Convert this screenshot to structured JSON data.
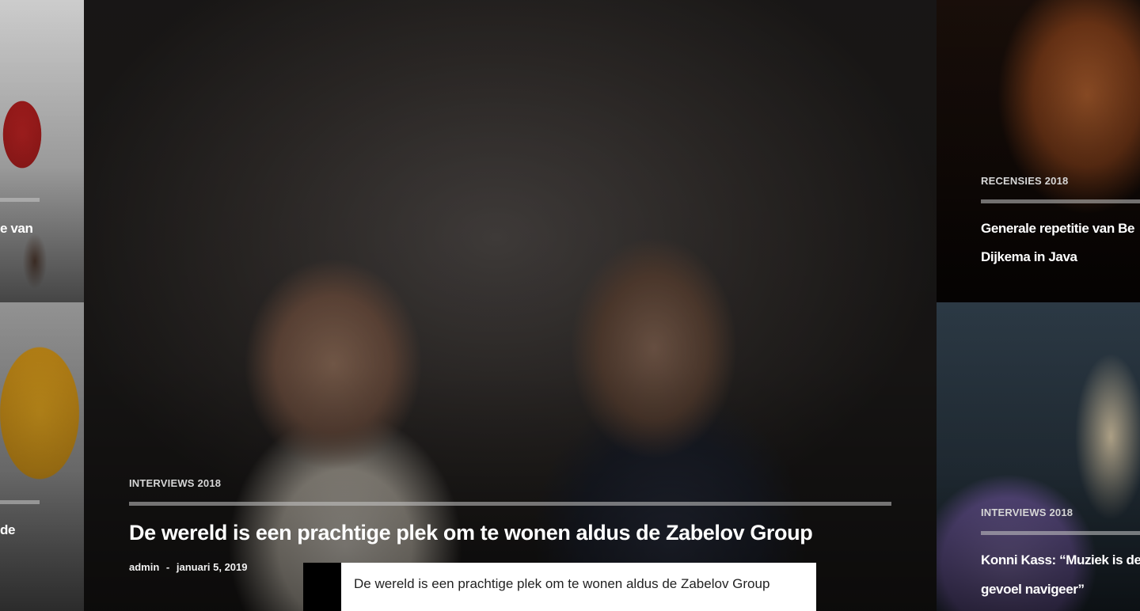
{
  "hero": {
    "category": "INTERVIEWS 2018",
    "title": "De wereld is een prachtige plek om te wonen aldus de Zabelov Group",
    "author": "admin",
    "separator": "-",
    "date": "januari 5, 2019"
  },
  "left_top": {
    "title_fragment": "e van"
  },
  "left_bottom": {
    "title_fragment": "de"
  },
  "right_top": {
    "category": "RECENSIES 2018",
    "title_line1": "Generale repetitie van Be",
    "title_line2": "Dijkema in Java"
  },
  "right_bottom": {
    "category": "INTERVIEWS 2018",
    "title_line1": "Konni Kass: “Muziek is de",
    "title_line2": "gevoel navigeer”"
  },
  "tooltip": {
    "text": "De wereld is een prachtige plek om te wonen aldus de Zabelov Group"
  }
}
